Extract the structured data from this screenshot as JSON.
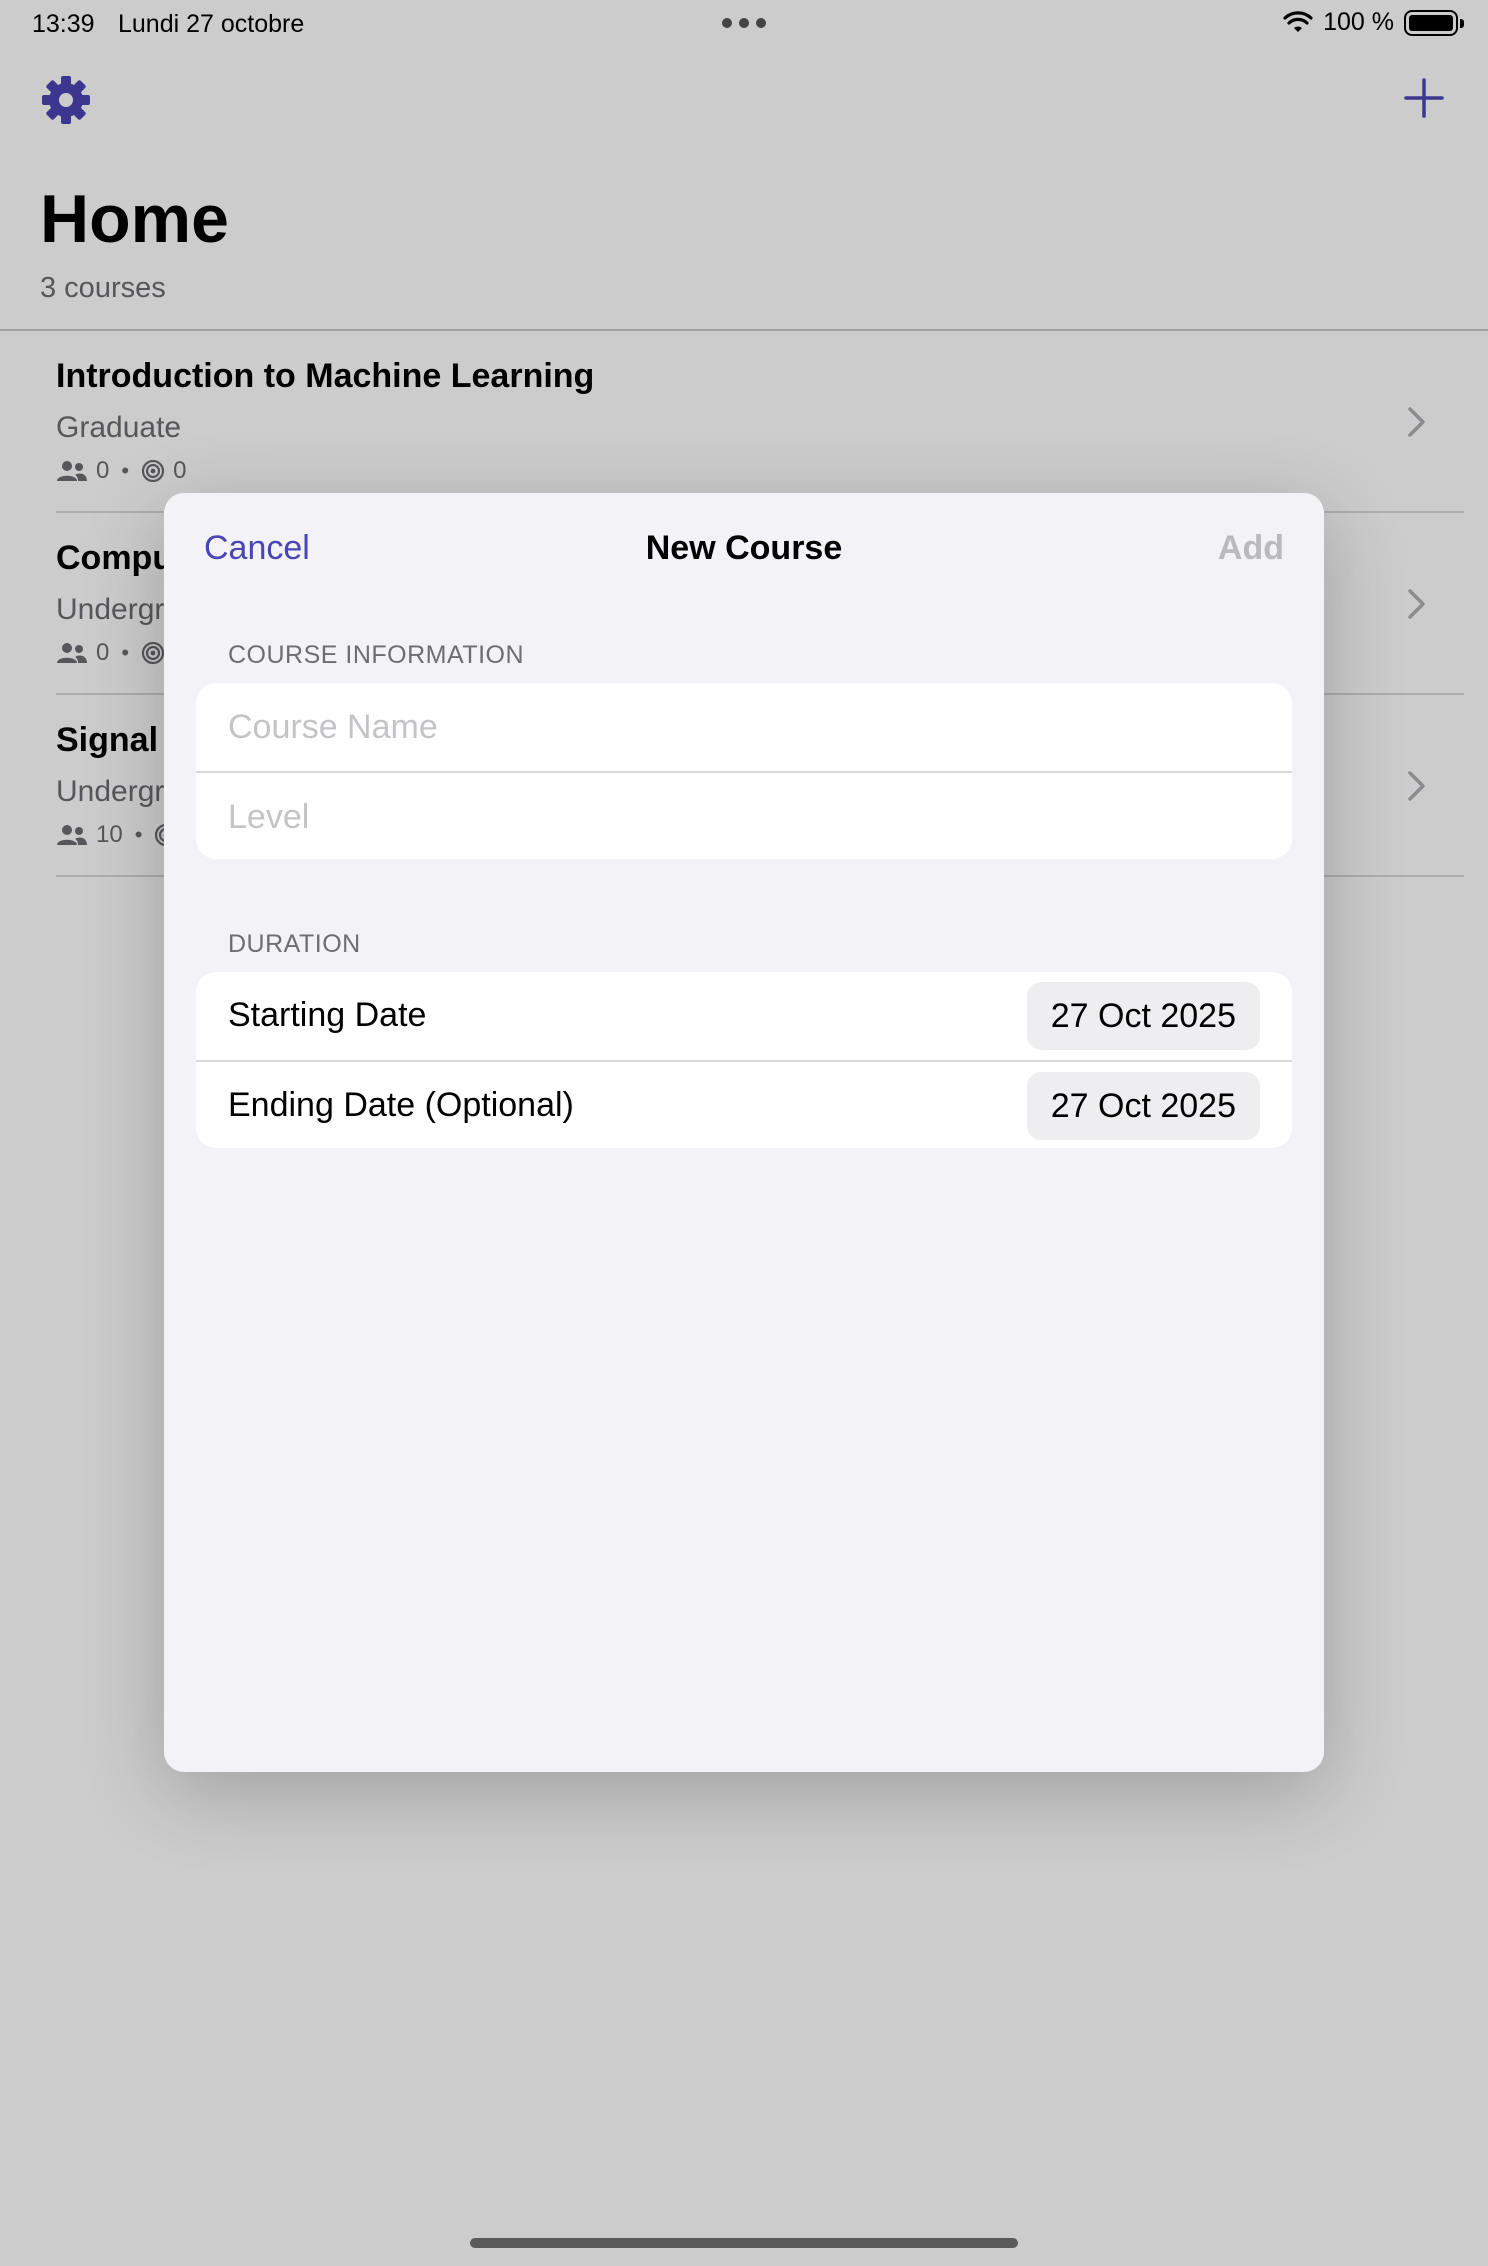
{
  "status_bar": {
    "time": "13:39",
    "date": "Lundi 27 octobre",
    "battery_text": "100 %",
    "battery_level": 1.0
  },
  "nav": {
    "settings_icon": "gear-icon",
    "add_icon": "plus-icon"
  },
  "home": {
    "title": "Home",
    "subtitle": "3 courses"
  },
  "courses": [
    {
      "name": "Introduction to Machine Learning",
      "level": "Graduate",
      "students": "0",
      "goals": "0"
    },
    {
      "name": "Compu",
      "level": "Undergr",
      "students": "0",
      "goals": ""
    },
    {
      "name": "Signal",
      "level": "Undergr",
      "students": "10",
      "goals": ""
    }
  ],
  "modal": {
    "title": "New Course",
    "cancel_label": "Cancel",
    "add_label": "Add",
    "course_info_header": "COURSE INFORMATION",
    "course_name_placeholder": "Course Name",
    "course_name_value": "",
    "level_placeholder": "Level",
    "level_value": "",
    "duration_header": "DURATION",
    "starting_date_label": "Starting Date",
    "starting_date_value": "27 Oct 2025",
    "ending_date_label": "Ending Date (Optional)",
    "ending_date_value": "27 Oct 2025"
  },
  "colors": {
    "accent": "#4a45b5",
    "disabled": "#b9b9bf",
    "secondary_text": "#6d6d72",
    "modal_background": "#f2f2f7"
  }
}
